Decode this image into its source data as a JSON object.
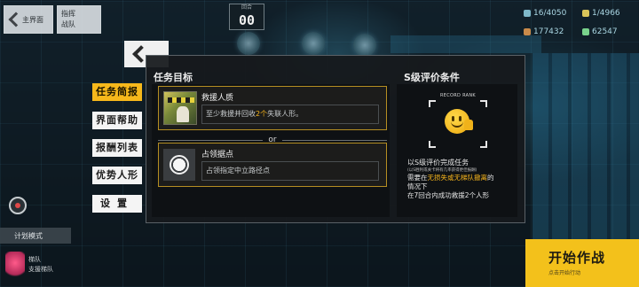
{
  "top": {
    "back_label": "主界面",
    "plan_label_1": "指挥",
    "plan_label_2": "战队",
    "turn_label": "回合",
    "turn_value": "00",
    "resources": [
      "16/4050",
      "1/4966",
      "177432",
      "62547"
    ]
  },
  "hud": {
    "plan_mode": "计划模式",
    "echelon_line_1": "梯队",
    "echelon_line_2": "支援梯队"
  },
  "start": {
    "label": "开始作战",
    "sub": "点击开始行动"
  },
  "menu": {
    "tabs": [
      "任务简报",
      "界面帮助",
      "报酬列表",
      "优势人形",
      "设置"
    ],
    "active_tab": "任务简报"
  },
  "mission": {
    "title": "任务目标",
    "or_text": "or",
    "objectives": [
      {
        "name": "救援人质",
        "desc_prefix": "至少救援并回收",
        "desc_highlight": "2个",
        "desc_suffix": "失联人形。"
      },
      {
        "name": "占领据点",
        "desc": "占领指定中立路径点"
      }
    ]
  },
  "rank": {
    "title": "S级评价条件",
    "record_label": "RECORD RANK",
    "line1": "以S级评价完成任务",
    "line1_note": "(以S胜利或关卡将有几率获得更佳报酬)",
    "line2_prefix": "需要在",
    "line2_highlight": "无损失或无梯队撤离",
    "line2_suffix": "的",
    "line3": "情况下",
    "line4": "在7回合内成功救援2个人形"
  },
  "colors": {
    "accent": "#f7b81b",
    "highlight_text": "#f3b21c",
    "panel_bg": "#16191c"
  }
}
